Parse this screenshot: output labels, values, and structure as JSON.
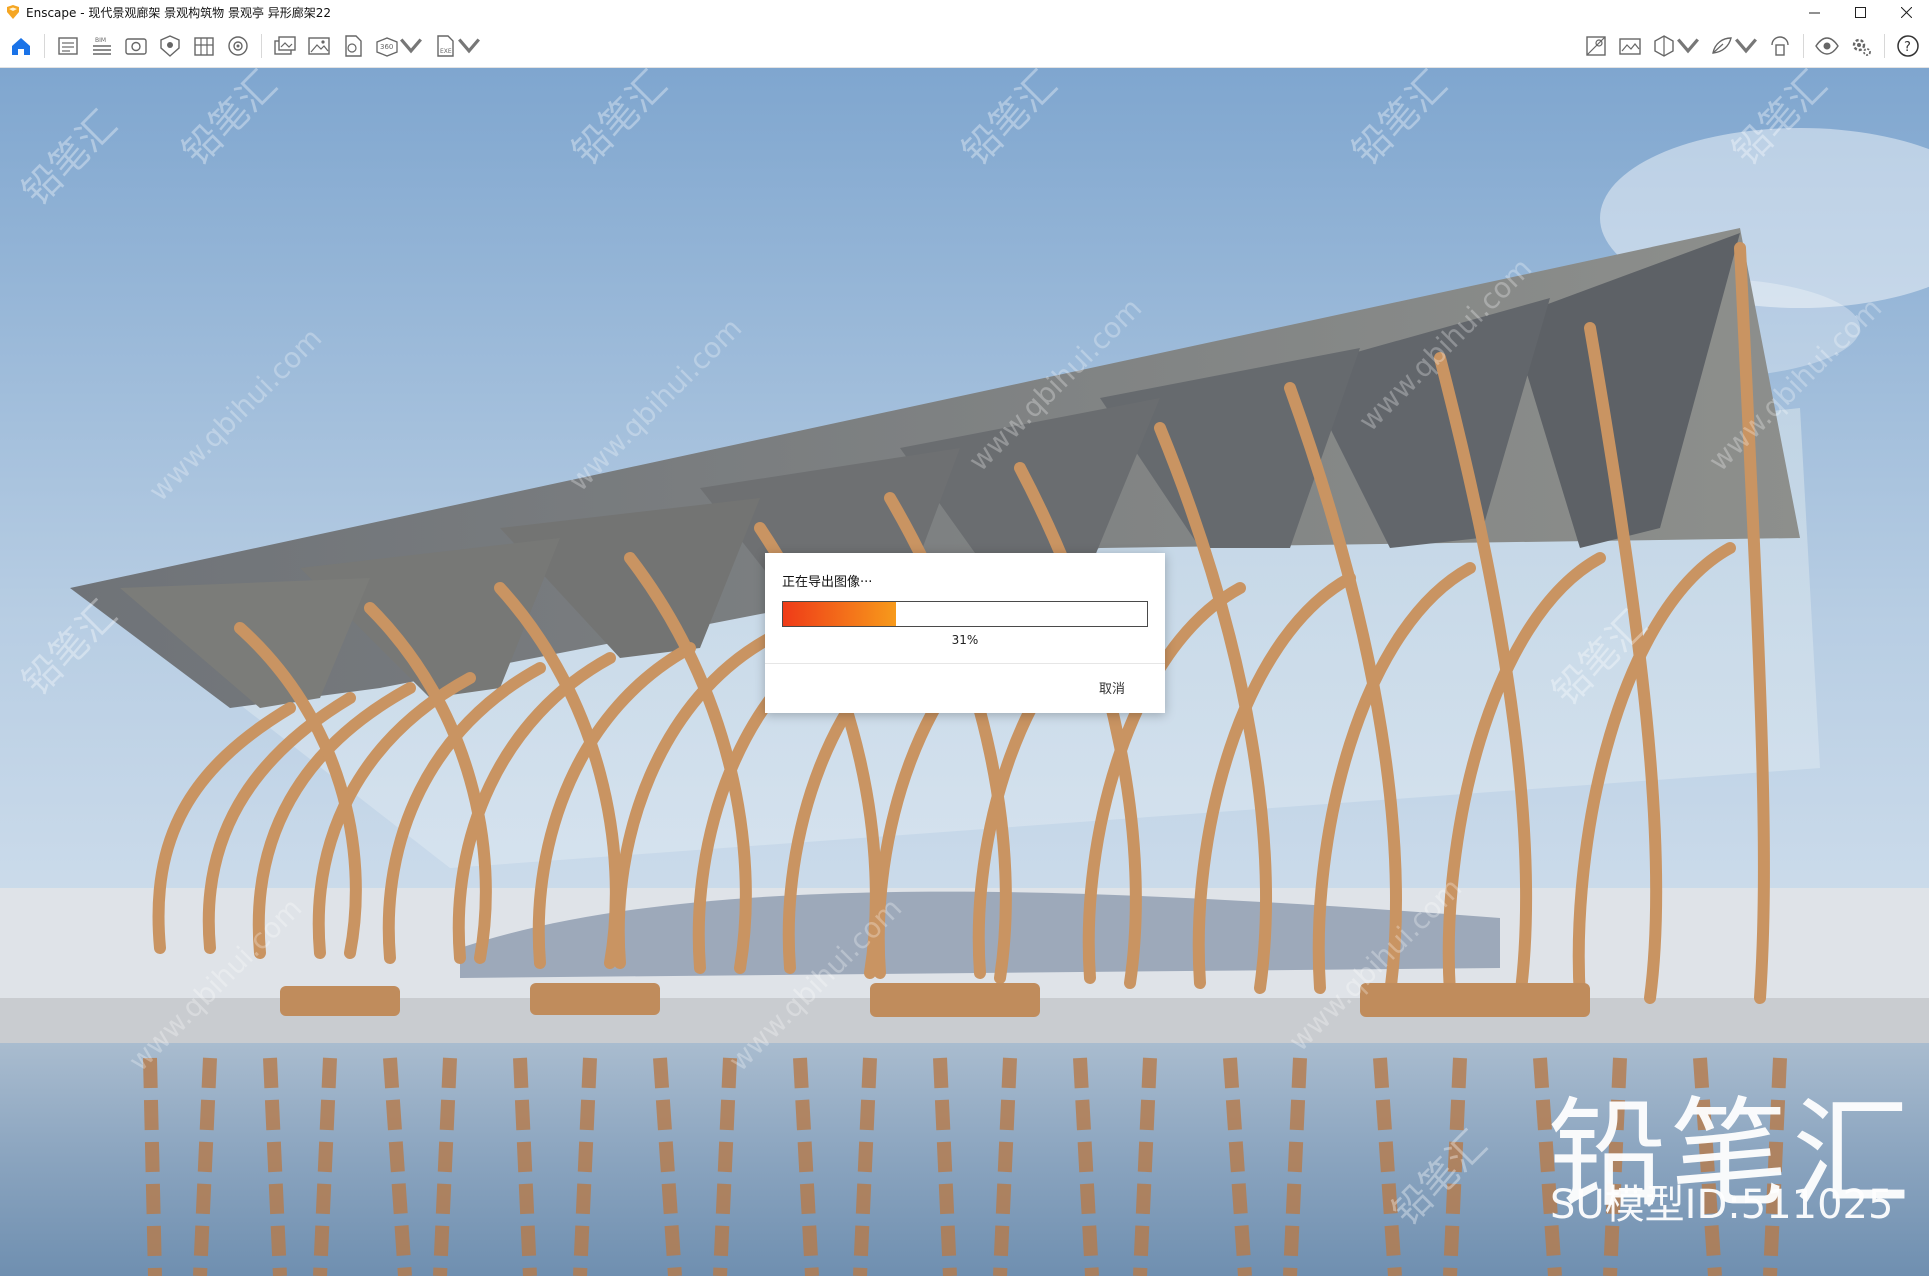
{
  "window": {
    "title": "Enscape - 现代景观廊架 景观构筑物 景观亭 异形廊架22",
    "controls": {
      "minimize": "minimize-icon",
      "maximize": "maximize-icon",
      "close": "close-icon"
    }
  },
  "toolbar": {
    "left_icons": [
      "home-icon",
      "sketchup-views-icon",
      "bim-icon",
      "walk-view-icon",
      "asset-library-icon",
      "material-editor-icon",
      "render-settings-icon",
      "batch-render-icon",
      "screenshot-icon",
      "export-image-icon",
      "panorama-360-icon",
      "export-exe-icon"
    ],
    "right_icons": [
      "visual-settings-icon",
      "capture-icon",
      "section-view-icon",
      "feedback-icon",
      "sync-icon",
      "live-update-icon",
      "settings-icon",
      "help-icon"
    ],
    "collapse_icon": "chevron-up-icon",
    "accent": "#1a73e8"
  },
  "viewport": {
    "watermark": {
      "brand": "铅笔汇",
      "id_text": "SU模型ID:511025",
      "diag_text": "铅笔汇",
      "url_text": "www.qbihui.com"
    }
  },
  "dialog": {
    "title": "正在导出图像···",
    "progress": 0.31,
    "progress_label": "31%",
    "cancel_label": "取消",
    "bar_color_start": "#ef3b18",
    "bar_color_end": "#f79a1b"
  }
}
